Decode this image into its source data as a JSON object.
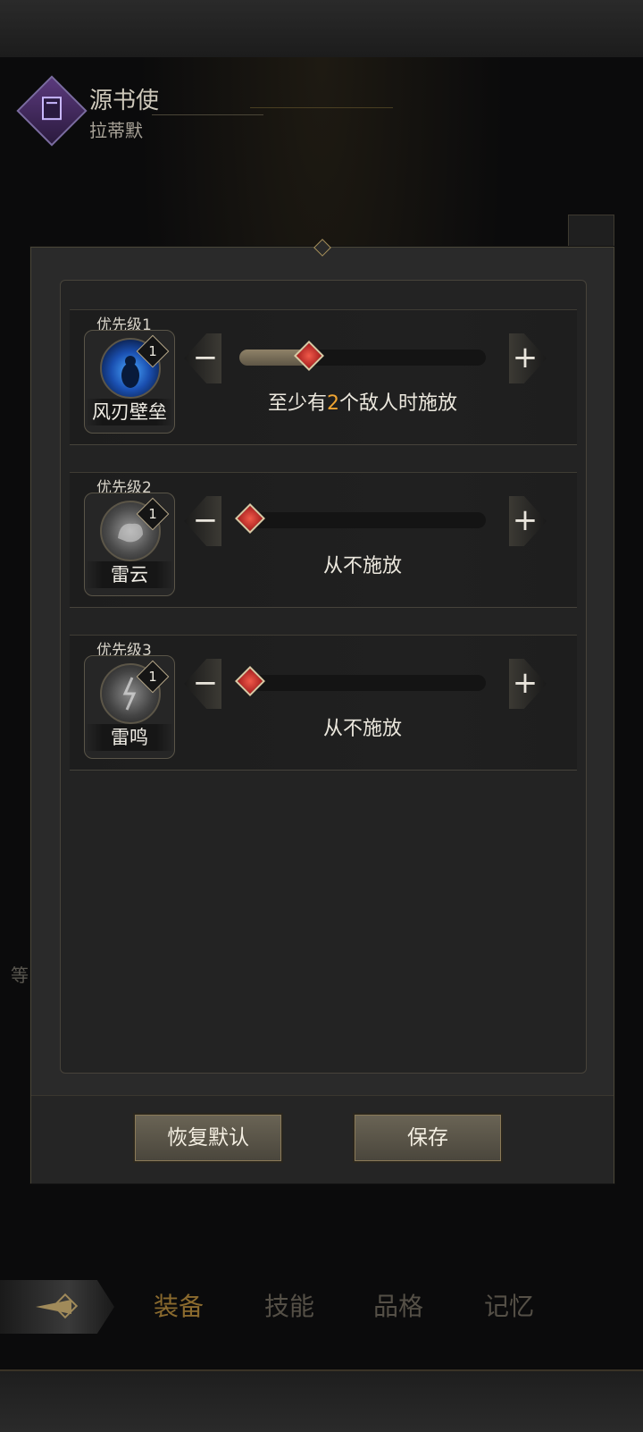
{
  "character": {
    "class_name": "源书使",
    "name": "拉蒂默"
  },
  "background": {
    "side_text": "等"
  },
  "nav": {
    "tabs": [
      {
        "label": "装备",
        "active": true
      },
      {
        "label": "技能",
        "active": false
      },
      {
        "label": "品格",
        "active": false
      },
      {
        "label": "记忆",
        "active": false
      }
    ]
  },
  "skills": [
    {
      "priority": "优先级1",
      "name": "风刃壁垒",
      "level": "1",
      "slider_fraction": 0.25,
      "desc_prefix": "至少有",
      "desc_value": "2",
      "desc_suffix": "个敌人时施放",
      "icon": "wind-barrier-icon"
    },
    {
      "priority": "优先级2",
      "name": "雷云",
      "level": "1",
      "slider_fraction": 0.0,
      "desc_prefix": "",
      "desc_value": "",
      "desc_suffix": "从不施放",
      "icon": "thundercloud-icon"
    },
    {
      "priority": "优先级3",
      "name": "雷鸣",
      "level": "1",
      "slider_fraction": 0.0,
      "desc_prefix": "",
      "desc_value": "",
      "desc_suffix": "从不施放",
      "icon": "thunder-roar-icon"
    }
  ],
  "buttons": {
    "minus": "−",
    "plus": "+",
    "reset": "恢复默认",
    "save": "保存"
  },
  "colors": {
    "highlight": "#f0a532",
    "knob": "#d83a32",
    "panel": "#2a2a2a"
  }
}
